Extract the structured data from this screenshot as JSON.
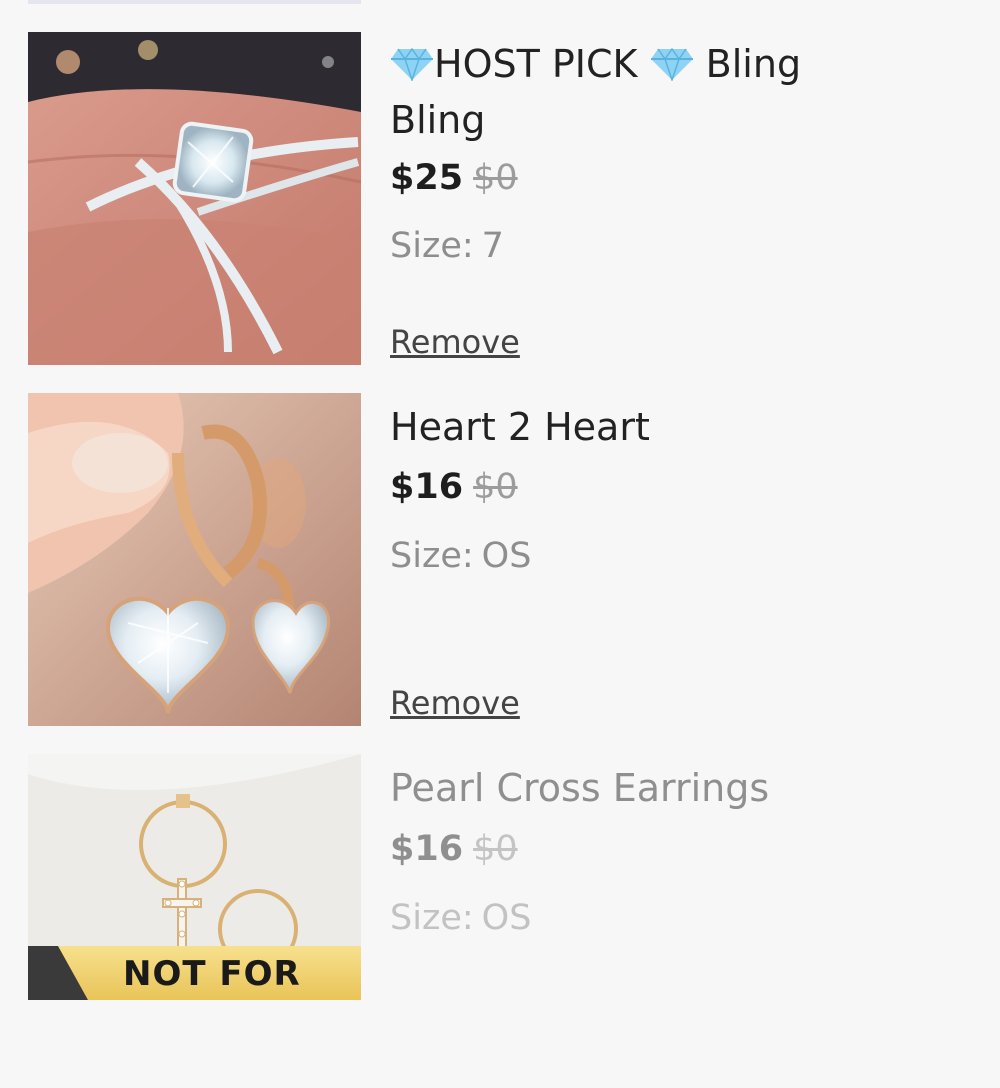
{
  "colors": {
    "page_background": "#f7f7f8",
    "price": "#1e1e1e",
    "strikethrough_price": "#9c9c9c",
    "size_text": "#8e8e8e",
    "not_for_sale_banner": "#f3d36b"
  },
  "items": [
    {
      "title_line1": "HOST PICK",
      "title_line2": "Bling Bling",
      "title_icon": "gem-icon",
      "price": "$25",
      "original_price": "$0",
      "size_label": "Size:",
      "size_value": "7",
      "remove_label": "Remove",
      "image": "crisscross-diamond-ring-photo"
    },
    {
      "title": "Heart 2 Heart",
      "price": "$16",
      "original_price": "$0",
      "size_label": "Size:",
      "size_value": "OS",
      "remove_label": "Remove",
      "image": "heart-crystal-hoop-earrings-photo"
    },
    {
      "title": "Pearl Cross Earrings",
      "price": "$16",
      "original_price": "$0",
      "size_label": "Size:",
      "size_value": "OS",
      "image": "pearl-cross-hoop-earrings-photo",
      "banner_text": "NOT FOR"
    }
  ]
}
